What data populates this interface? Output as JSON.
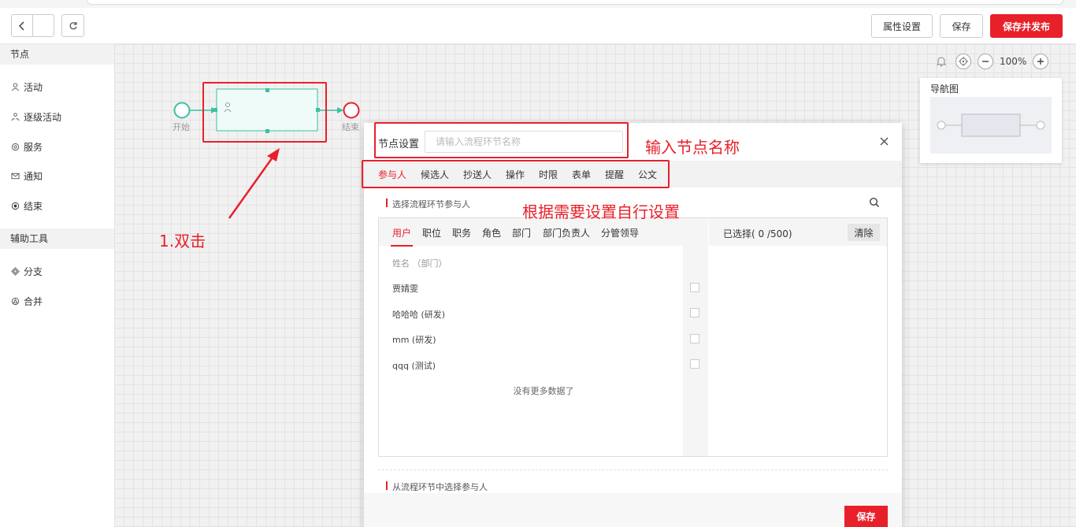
{
  "toolbar": {
    "properties_label": "属性设置",
    "save_label": "保存",
    "save_publish_label": "保存并发布",
    "accent": "#e8202a"
  },
  "sidebar": {
    "nodes_section": "节点",
    "node_items": [
      {
        "label": "活动",
        "icon": "person-icon"
      },
      {
        "label": "逐级活动",
        "icon": "people-icon"
      },
      {
        "label": "服务",
        "icon": "gear-icon"
      },
      {
        "label": "通知",
        "icon": "mail-icon"
      },
      {
        "label": "结束",
        "icon": "stop-circle-icon"
      }
    ],
    "tools_section": "辅助工具",
    "tool_items": [
      {
        "label": "分支",
        "icon": "diamond-icon"
      },
      {
        "label": "合并",
        "icon": "merge-icon"
      }
    ]
  },
  "canvas": {
    "start_label": "开始",
    "end_label": "结束",
    "zoom": "100%",
    "minimap_title": "导航图"
  },
  "annotations": {
    "double_click": "1.双击",
    "enter_name": "输入节点名称",
    "configure": "根据需要设置自行设置"
  },
  "dialog": {
    "title": "节点设置",
    "name_placeholder": "请输入流程环节名称",
    "tabs": [
      "参与人",
      "候选人",
      "抄送人",
      "操作",
      "时限",
      "表单",
      "提醒",
      "公文"
    ],
    "section1": "选择流程环节参与人",
    "subtabs": [
      "用户",
      "职位",
      "职务",
      "角色",
      "部门",
      "部门负责人",
      "分管领导"
    ],
    "list_header": "姓名 （部门）",
    "rows": [
      "贾婧雯",
      "哈哈哈 (研发)",
      "mm (研发)",
      "qqq (测试)"
    ],
    "no_more": "没有更多数据了",
    "selected_label": "已选择( 0 /500)",
    "clear_label": "清除",
    "section2": "从流程环节中选择参与人",
    "save_label": "保存"
  }
}
